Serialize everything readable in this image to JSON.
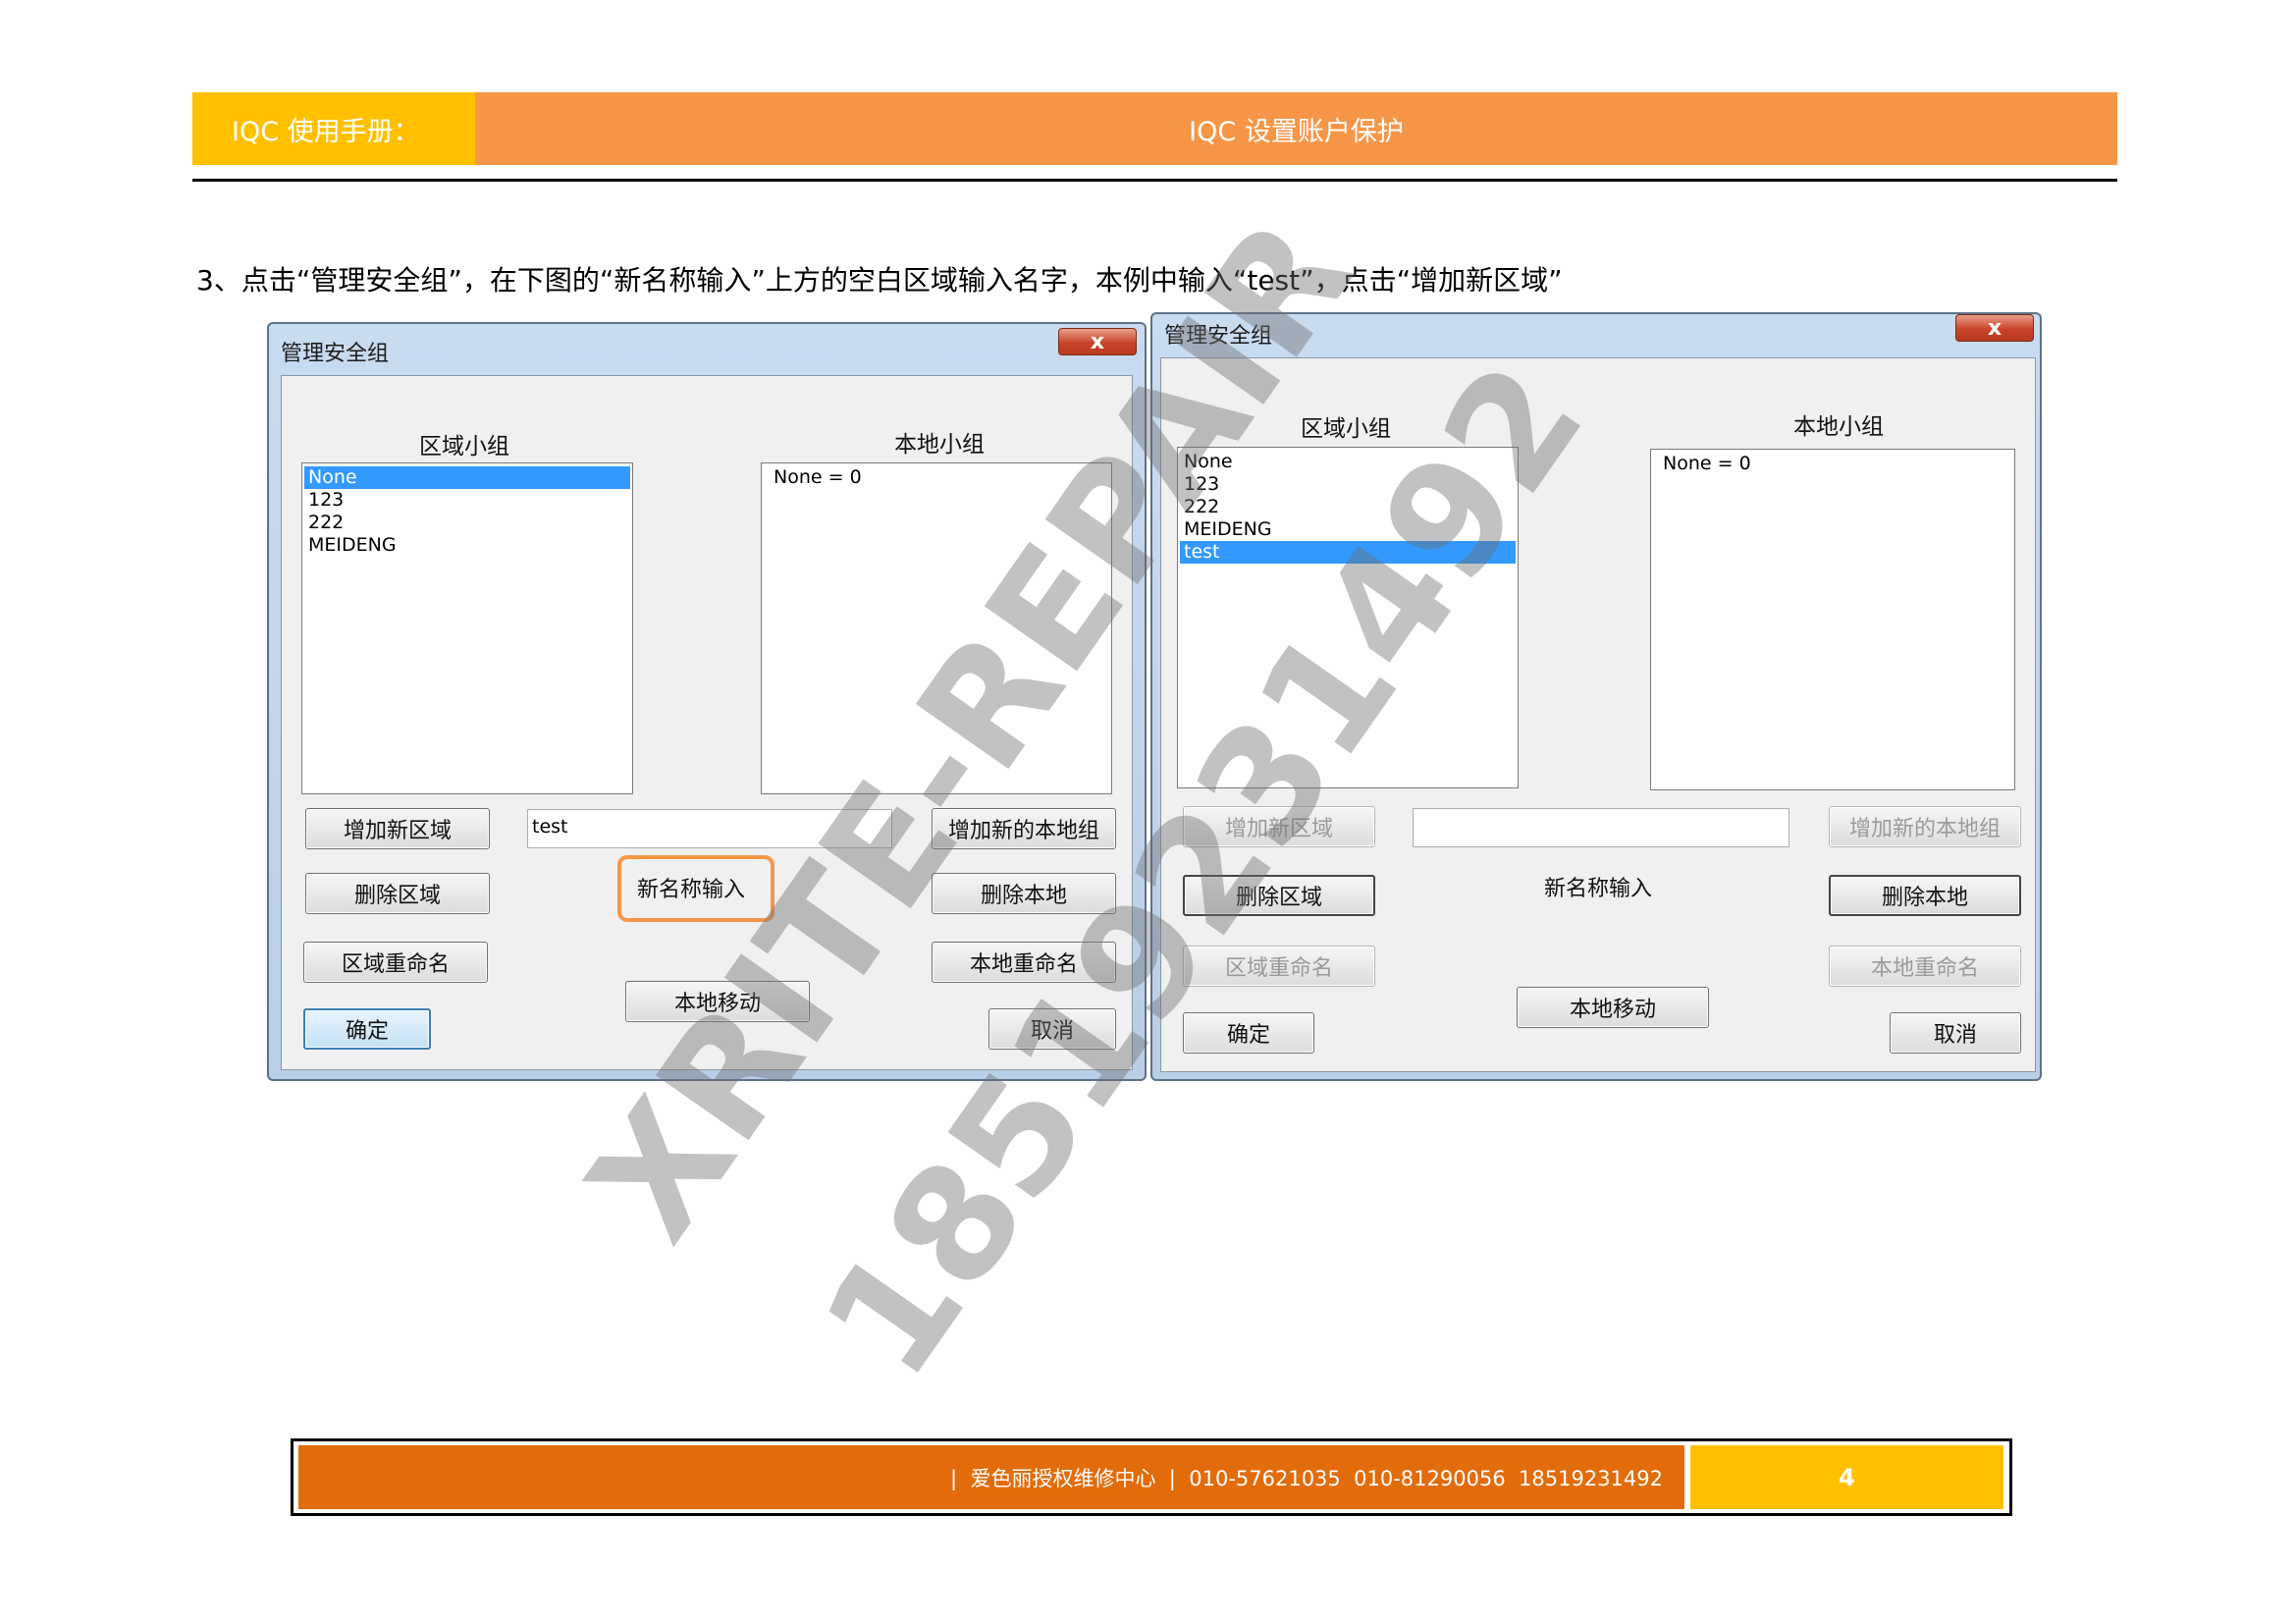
{
  "header": {
    "left_title": "IQC 使用手册：",
    "right_title": "IQC 设置账户保护"
  },
  "instruction": "3、点击“管理安全组”，在下图的“新名称输入”上方的空白区域输入名字，本例中输入“test”，点击“增加新区域”",
  "dialog_left": {
    "title": "管理安全组",
    "close_glyph": "x",
    "region_group_label": "区域小组",
    "local_group_label": "本地小组",
    "region_items": [
      "None",
      "123",
      "222",
      "MEIDENG"
    ],
    "selected_region_index": 0,
    "local_items": [
      "None = 0"
    ],
    "new_name_value": "test",
    "new_name_label": "新名称输入",
    "buttons": {
      "add_region": "增加新区域",
      "delete_region": "删除区域",
      "rename_region": "区域重命名",
      "ok": "确定",
      "add_local": "增加新的本地组",
      "delete_local": "删除本地",
      "rename_local": "本地重命名",
      "move_local": "本地移动",
      "cancel": "取消"
    }
  },
  "dialog_right": {
    "title": "管理安全组",
    "close_glyph": "x",
    "region_group_label": "区域小组",
    "local_group_label": "本地小组",
    "region_items": [
      "None",
      "123",
      "222",
      "MEIDENG",
      "test"
    ],
    "selected_region_index": 4,
    "local_items": [
      "None = 0"
    ],
    "new_name_value": "",
    "new_name_label": "新名称输入",
    "buttons": {
      "add_region": "增加新区域",
      "delete_region": "删除区域",
      "rename_region": "区域重命名",
      "ok": "确定",
      "add_local": "增加新的本地组",
      "delete_local": "删除本地",
      "rename_local": "本地重命名",
      "move_local": "本地移动",
      "cancel": "取消"
    }
  },
  "watermark": {
    "line1": "XRITE-REPAIR",
    "line2": "18519231492"
  },
  "footer": {
    "contact": "|  爱色丽授权维修中心  |  010-57621035  010-81290056  18519231492",
    "page_number": "4"
  },
  "colors": {
    "header_left": "#ffc000",
    "header_right": "#f79646",
    "footer_left": "#e36c0a",
    "footer_right": "#ffc000",
    "selection": "#3399ff",
    "highlight_box": "#f79646"
  }
}
